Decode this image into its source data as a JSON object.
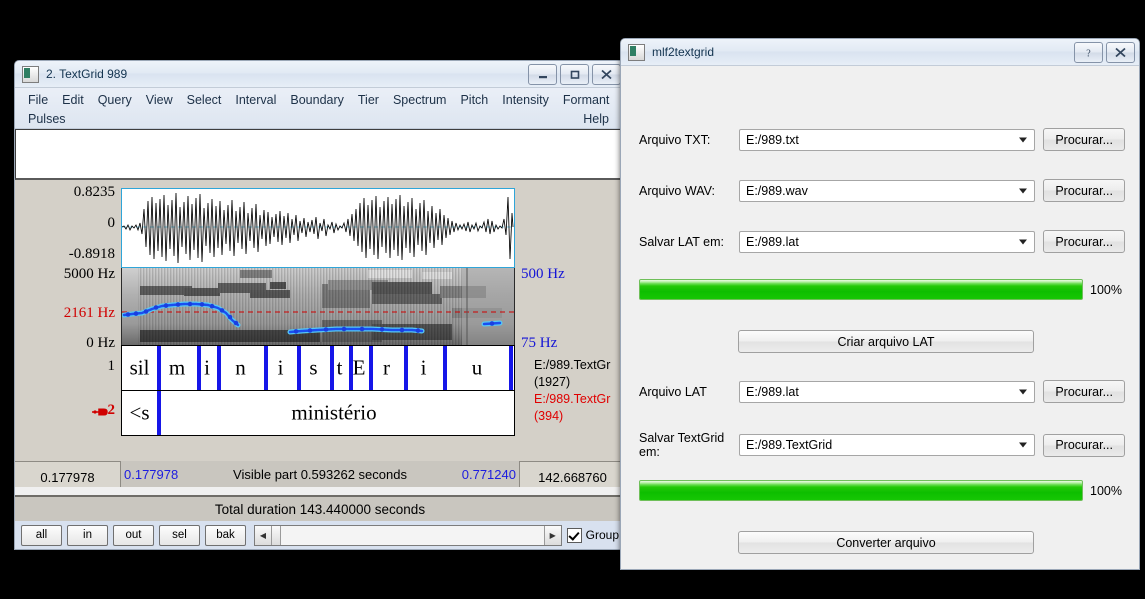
{
  "praat": {
    "title": "2. TextGrid 989",
    "title_buttons": [
      {
        "name": "minimize-button",
        "glyph": "minimize"
      },
      {
        "name": "maximize-button",
        "glyph": "maximize"
      },
      {
        "name": "close-button",
        "glyph": "close"
      }
    ],
    "menus_row1": [
      "File",
      "Edit",
      "Query",
      "View",
      "Select",
      "Interval",
      "Boundary",
      "Tier",
      "Spectrum",
      "Pitch",
      "Intensity",
      "Formant"
    ],
    "menus_row2": [
      "Pulses"
    ],
    "help_label": "Help",
    "axis": {
      "wave_max": "0.8235",
      "wave_zero": "0",
      "wave_min": "-0.8918",
      "spec_max": "5000 Hz",
      "spec_cursor": "2161 Hz",
      "spec_min": "0 Hz",
      "pitch_max": "500 Hz",
      "pitch_min": "75 Hz"
    },
    "tiers": [
      {
        "number": "1",
        "selected": false,
        "file_label": "E:/989.TextGr",
        "file_count": "(1927)",
        "intervals": [
          {
            "text": "sil",
            "start": 0,
            "end": 35
          },
          {
            "text": "m",
            "start": 35,
            "end": 75
          },
          {
            "text": "i",
            "start": 75,
            "end": 95
          },
          {
            "text": "n",
            "start": 95,
            "end": 142
          },
          {
            "text": "i",
            "start": 142,
            "end": 175
          },
          {
            "text": "s",
            "start": 175,
            "end": 208
          },
          {
            "text": "t",
            "start": 208,
            "end": 227
          },
          {
            "text": "E",
            "start": 227,
            "end": 247
          },
          {
            "text": "r",
            "start": 247,
            "end": 282
          },
          {
            "text": "i",
            "start": 282,
            "end": 321
          },
          {
            "text": "u",
            "start": 321,
            "end": 389
          }
        ]
      },
      {
        "number": "2",
        "selected": true,
        "file_label": "E:/989.TextGr",
        "file_count": "(394)",
        "intervals": [
          {
            "text": "<s",
            "start": 0,
            "end": 35
          },
          {
            "text": "ministério",
            "start": 35,
            "end": 389
          }
        ]
      }
    ],
    "time": {
      "left_edge": "0.177978",
      "window_start": "0.177978",
      "visible_part": "Visible part 0.593262 seconds",
      "window_end": "0.771240",
      "right_edge": "142.668760",
      "total_duration": "Total duration 143.440000 seconds"
    },
    "zoom_buttons": [
      "all",
      "in",
      "out",
      "sel",
      "bak"
    ],
    "group_checkbox": {
      "label": "Group",
      "checked": true
    }
  },
  "dialog": {
    "title": "mlf2textgrid",
    "title_buttons": [
      {
        "name": "help-button",
        "glyph": "help"
      },
      {
        "name": "close-button",
        "glyph": "close"
      }
    ],
    "fields": [
      {
        "label": "Arquivo TXT:",
        "value": "E:/989.txt",
        "button": "Procurar..."
      },
      {
        "label": "Arquivo WAV:",
        "value": "E:/989.wav",
        "button": "Procurar..."
      },
      {
        "label": "Salvar LAT em:",
        "value": "E:/989.lat",
        "button": "Procurar..."
      },
      {
        "label": "Arquivo LAT",
        "value": "E:/989.lat",
        "button": "Procurar..."
      },
      {
        "label": "Salvar TextGrid em:",
        "value": "E:/989.TextGrid",
        "button": "Procurar..."
      }
    ],
    "progress_lat": {
      "percent": 100,
      "label": "100%"
    },
    "progress_textgrid": {
      "percent": 100,
      "label": "100%"
    },
    "action_lat": "Criar arquivo LAT",
    "action_convert": "Converter arquivo"
  },
  "colors": {
    "accent_blue": "#1616e8",
    "cursor_red": "#d00000",
    "progress_green": "#0dbe00",
    "desktop": "#000000"
  }
}
